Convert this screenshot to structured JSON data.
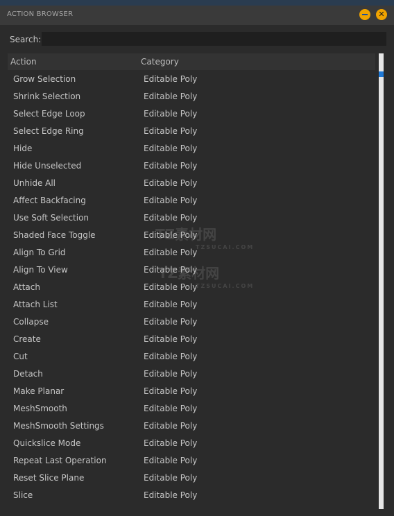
{
  "window": {
    "title": "ACTION BROWSER"
  },
  "search": {
    "label": "Search:",
    "value": ""
  },
  "table": {
    "columns": [
      "Action",
      "Category"
    ],
    "rows": [
      [
        "Grow Selection",
        "Editable Poly"
      ],
      [
        "Shrink Selection",
        "Editable Poly"
      ],
      [
        "Select Edge Loop",
        "Editable Poly"
      ],
      [
        "Select Edge Ring",
        "Editable Poly"
      ],
      [
        "Hide",
        "Editable Poly"
      ],
      [
        "Hide Unselected",
        "Editable Poly"
      ],
      [
        "Unhide All",
        "Editable Poly"
      ],
      [
        "Affect Backfacing",
        "Editable Poly"
      ],
      [
        "Use Soft Selection",
        "Editable Poly"
      ],
      [
        "Shaded Face Toggle",
        "Editable Poly"
      ],
      [
        "Align To Grid",
        "Editable Poly"
      ],
      [
        "Align To View",
        "Editable Poly"
      ],
      [
        "Attach",
        "Editable Poly"
      ],
      [
        "Attach List",
        "Editable Poly"
      ],
      [
        "Collapse",
        "Editable Poly"
      ],
      [
        "Create",
        "Editable Poly"
      ],
      [
        "Cut",
        "Editable Poly"
      ],
      [
        "Detach",
        "Editable Poly"
      ],
      [
        "Make Planar",
        "Editable Poly"
      ],
      [
        "MeshSmooth",
        "Editable Poly"
      ],
      [
        "MeshSmooth Settings",
        "Editable Poly"
      ],
      [
        "Quickslice Mode",
        "Editable Poly"
      ],
      [
        "Repeat Last Operation",
        "Editable Poly"
      ],
      [
        "Reset Slice Plane",
        "Editable Poly"
      ],
      [
        "Slice",
        "Editable Poly"
      ]
    ]
  },
  "watermark": {
    "brand": "TZ素材网",
    "site": "TZSUCAI.COM"
  },
  "colors": {
    "accent": "#f0a300",
    "scroll_thumb": "#1e78d6",
    "background": "#2b2b2b"
  },
  "icons": {
    "minimize": "minimize-icon",
    "close": "close-icon"
  }
}
